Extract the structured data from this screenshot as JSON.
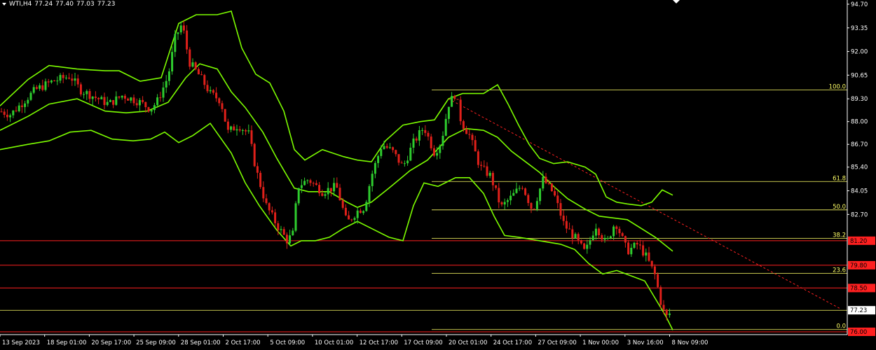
{
  "header": {
    "symbol": "WTI,H4",
    "open": "77.24",
    "high": "77.40",
    "low": "77.03",
    "close": "77.23"
  },
  "colors": {
    "bg": "#000000",
    "band": "#7CFC00",
    "bull": "#2ecc2e",
    "bear": "#e0201a",
    "fib": "#ffff66",
    "level": "#ff2020",
    "trend": "#ff2020",
    "axis": "#ffffff"
  },
  "chart_data": {
    "type": "candlestick",
    "title": "",
    "ylim": [
      75.9,
      95.1
    ],
    "y_ticks": [
      "94.70",
      "93.35",
      "92.00",
      "90.65",
      "89.30",
      "88.00",
      "86.70",
      "85.40",
      "84.05",
      "82.70"
    ],
    "x_ticks": [
      "13 Sep 2023",
      "18 Sep 01:00",
      "20 Sep 17:00",
      "25 Sep 09:00",
      "28 Sep 01:00",
      "2 Oct 17:00",
      "5 Oct 09:00",
      "10 Oct 01:00",
      "12 Oct 17:00",
      "17 Oct 09:00",
      "20 Oct 01:00",
      "24 Oct 17:00",
      "27 Oct 09:00",
      "1 Nov 00:00",
      "3 Nov 16:00",
      "8 Nov 09:00"
    ],
    "price_path": [
      [
        0,
        88.6
      ],
      [
        15,
        88.4
      ],
      [
        30,
        89.0
      ],
      [
        50,
        89.8
      ],
      [
        75,
        90.3
      ],
      [
        100,
        90.6
      ],
      [
        115,
        89.8
      ],
      [
        135,
        89.4
      ],
      [
        155,
        89.0
      ],
      [
        175,
        89.5
      ],
      [
        200,
        89.1
      ],
      [
        215,
        88.7
      ],
      [
        225,
        89.2
      ],
      [
        240,
        90.6
      ],
      [
        250,
        92.8
      ],
      [
        260,
        93.6
      ],
      [
        270,
        91.4
      ],
      [
        285,
        90.6
      ],
      [
        300,
        89.6
      ],
      [
        315,
        89.2
      ],
      [
        325,
        87.4
      ],
      [
        340,
        87.8
      ],
      [
        355,
        87.3
      ],
      [
        365,
        85.3
      ],
      [
        380,
        83.2
      ],
      [
        395,
        82.1
      ],
      [
        410,
        81.2
      ],
      [
        418,
        81.6
      ],
      [
        425,
        84.3
      ],
      [
        440,
        84.7
      ],
      [
        460,
        84.0
      ],
      [
        480,
        84.3
      ],
      [
        495,
        82.2
      ],
      [
        510,
        82.9
      ],
      [
        520,
        83.1
      ],
      [
        530,
        84.9
      ],
      [
        545,
        86.7
      ],
      [
        560,
        86.3
      ],
      [
        575,
        85.4
      ],
      [
        590,
        86.8
      ],
      [
        605,
        87.7
      ],
      [
        620,
        86.2
      ],
      [
        630,
        86.9
      ],
      [
        640,
        89.0
      ],
      [
        650,
        89.6
      ],
      [
        658,
        88.0
      ],
      [
        670,
        87.2
      ],
      [
        685,
        85.4
      ],
      [
        700,
        84.9
      ],
      [
        715,
        83.1
      ],
      [
        730,
        83.7
      ],
      [
        745,
        84.4
      ],
      [
        760,
        82.9
      ],
      [
        775,
        84.7
      ],
      [
        790,
        83.9
      ],
      [
        805,
        82.1
      ],
      [
        820,
        81.4
      ],
      [
        835,
        80.5
      ],
      [
        850,
        82.1
      ],
      [
        865,
        81.0
      ],
      [
        878,
        82.3
      ],
      [
        895,
        80.6
      ],
      [
        910,
        81.0
      ],
      [
        922,
        80.3
      ],
      [
        935,
        79.2
      ],
      [
        945,
        77.3
      ],
      [
        952,
        76.8
      ],
      [
        958,
        77.23
      ]
    ],
    "bollinger_upper": [
      [
        0,
        88.9
      ],
      [
        40,
        90.4
      ],
      [
        70,
        91.2
      ],
      [
        110,
        91.0
      ],
      [
        150,
        90.9
      ],
      [
        170,
        90.9
      ],
      [
        200,
        90.3
      ],
      [
        230,
        90.5
      ],
      [
        255,
        93.6
      ],
      [
        280,
        94.1
      ],
      [
        310,
        94.1
      ],
      [
        330,
        94.3
      ],
      [
        345,
        92.2
      ],
      [
        365,
        90.7
      ],
      [
        385,
        90.2
      ],
      [
        405,
        88.6
      ],
      [
        420,
        86.4
      ],
      [
        435,
        85.8
      ],
      [
        460,
        86.4
      ],
      [
        490,
        86.0
      ],
      [
        510,
        85.8
      ],
      [
        530,
        85.7
      ],
      [
        550,
        86.9
      ],
      [
        575,
        87.8
      ],
      [
        600,
        88.0
      ],
      [
        620,
        88.1
      ],
      [
        640,
        89.3
      ],
      [
        660,
        89.6
      ],
      [
        690,
        89.6
      ],
      [
        710,
        90.1
      ],
      [
        725,
        89.0
      ],
      [
        740,
        87.8
      ],
      [
        755,
        86.7
      ],
      [
        770,
        85.9
      ],
      [
        790,
        85.6
      ],
      [
        810,
        85.7
      ],
      [
        835,
        85.4
      ],
      [
        850,
        85.0
      ],
      [
        865,
        83.7
      ],
      [
        880,
        83.4
      ],
      [
        895,
        83.3
      ],
      [
        915,
        83.2
      ],
      [
        930,
        83.4
      ],
      [
        945,
        84.1
      ],
      [
        960,
        83.8
      ]
    ],
    "bollinger_middle": [
      [
        0,
        87.5
      ],
      [
        40,
        88.3
      ],
      [
        70,
        89.0
      ],
      [
        110,
        89.3
      ],
      [
        150,
        88.6
      ],
      [
        180,
        88.5
      ],
      [
        210,
        88.6
      ],
      [
        240,
        89.1
      ],
      [
        265,
        90.5
      ],
      [
        285,
        91.3
      ],
      [
        310,
        91.0
      ],
      [
        330,
        89.7
      ],
      [
        350,
        88.8
      ],
      [
        375,
        87.4
      ],
      [
        395,
        85.9
      ],
      [
        420,
        84.2
      ],
      [
        440,
        84.0
      ],
      [
        470,
        84.0
      ],
      [
        495,
        83.4
      ],
      [
        510,
        83.1
      ],
      [
        530,
        83.4
      ],
      [
        555,
        84.2
      ],
      [
        585,
        85.2
      ],
      [
        610,
        85.8
      ],
      [
        640,
        87.1
      ],
      [
        665,
        87.6
      ],
      [
        690,
        87.5
      ],
      [
        710,
        87.1
      ],
      [
        730,
        86.3
      ],
      [
        750,
        85.7
      ],
      [
        770,
        85.1
      ],
      [
        790,
        84.3
      ],
      [
        810,
        83.6
      ],
      [
        835,
        83.0
      ],
      [
        855,
        82.6
      ],
      [
        875,
        82.5
      ],
      [
        895,
        82.4
      ],
      [
        915,
        81.9
      ],
      [
        935,
        81.4
      ],
      [
        960,
        80.6
      ]
    ],
    "bollinger_lower": [
      [
        0,
        86.4
      ],
      [
        40,
        86.7
      ],
      [
        70,
        86.9
      ],
      [
        100,
        87.4
      ],
      [
        130,
        87.5
      ],
      [
        160,
        87.0
      ],
      [
        190,
        86.9
      ],
      [
        215,
        87.0
      ],
      [
        235,
        87.4
      ],
      [
        255,
        86.8
      ],
      [
        275,
        87.2
      ],
      [
        300,
        87.9
      ],
      [
        330,
        86.2
      ],
      [
        350,
        84.5
      ],
      [
        370,
        83.2
      ],
      [
        395,
        81.8
      ],
      [
        415,
        80.9
      ],
      [
        430,
        81.2
      ],
      [
        450,
        81.2
      ],
      [
        470,
        81.4
      ],
      [
        490,
        81.9
      ],
      [
        510,
        82.3
      ],
      [
        530,
        81.9
      ],
      [
        555,
        81.4
      ],
      [
        575,
        81.2
      ],
      [
        590,
        83.2
      ],
      [
        605,
        84.5
      ],
      [
        625,
        84.3
      ],
      [
        650,
        84.8
      ],
      [
        670,
        84.8
      ],
      [
        690,
        83.9
      ],
      [
        705,
        82.6
      ],
      [
        720,
        81.5
      ],
      [
        740,
        81.4
      ],
      [
        770,
        81.2
      ],
      [
        800,
        81.0
      ],
      [
        820,
        80.7
      ],
      [
        840,
        79.9
      ],
      [
        860,
        79.3
      ],
      [
        880,
        79.5
      ],
      [
        900,
        79.2
      ],
      [
        920,
        78.9
      ],
      [
        935,
        77.9
      ],
      [
        950,
        76.9
      ],
      [
        960,
        76.1
      ]
    ],
    "fibonacci": {
      "levels": [
        {
          "label": "100.0",
          "value": 89.8
        },
        {
          "label": "61.8",
          "value": 84.58
        },
        {
          "label": "50.0",
          "value": 82.96
        },
        {
          "label": "38.2",
          "value": 81.34
        },
        {
          "label": "23.6",
          "value": 79.33
        },
        {
          "label": "0.0",
          "value": 76.13
        }
      ]
    },
    "price_levels": [
      {
        "label": "81.20",
        "value": 81.2
      },
      {
        "label": "79.80",
        "value": 79.8
      },
      {
        "label": "78.50",
        "value": 78.5
      },
      {
        "label": "76.00",
        "value": 76.0
      }
    ],
    "current_price": {
      "label": "77.23",
      "value": 77.23
    },
    "trendline": [
      {
        "x": 640,
        "y": 89.3
      },
      {
        "x": 1200,
        "y": 77.3
      }
    ]
  }
}
